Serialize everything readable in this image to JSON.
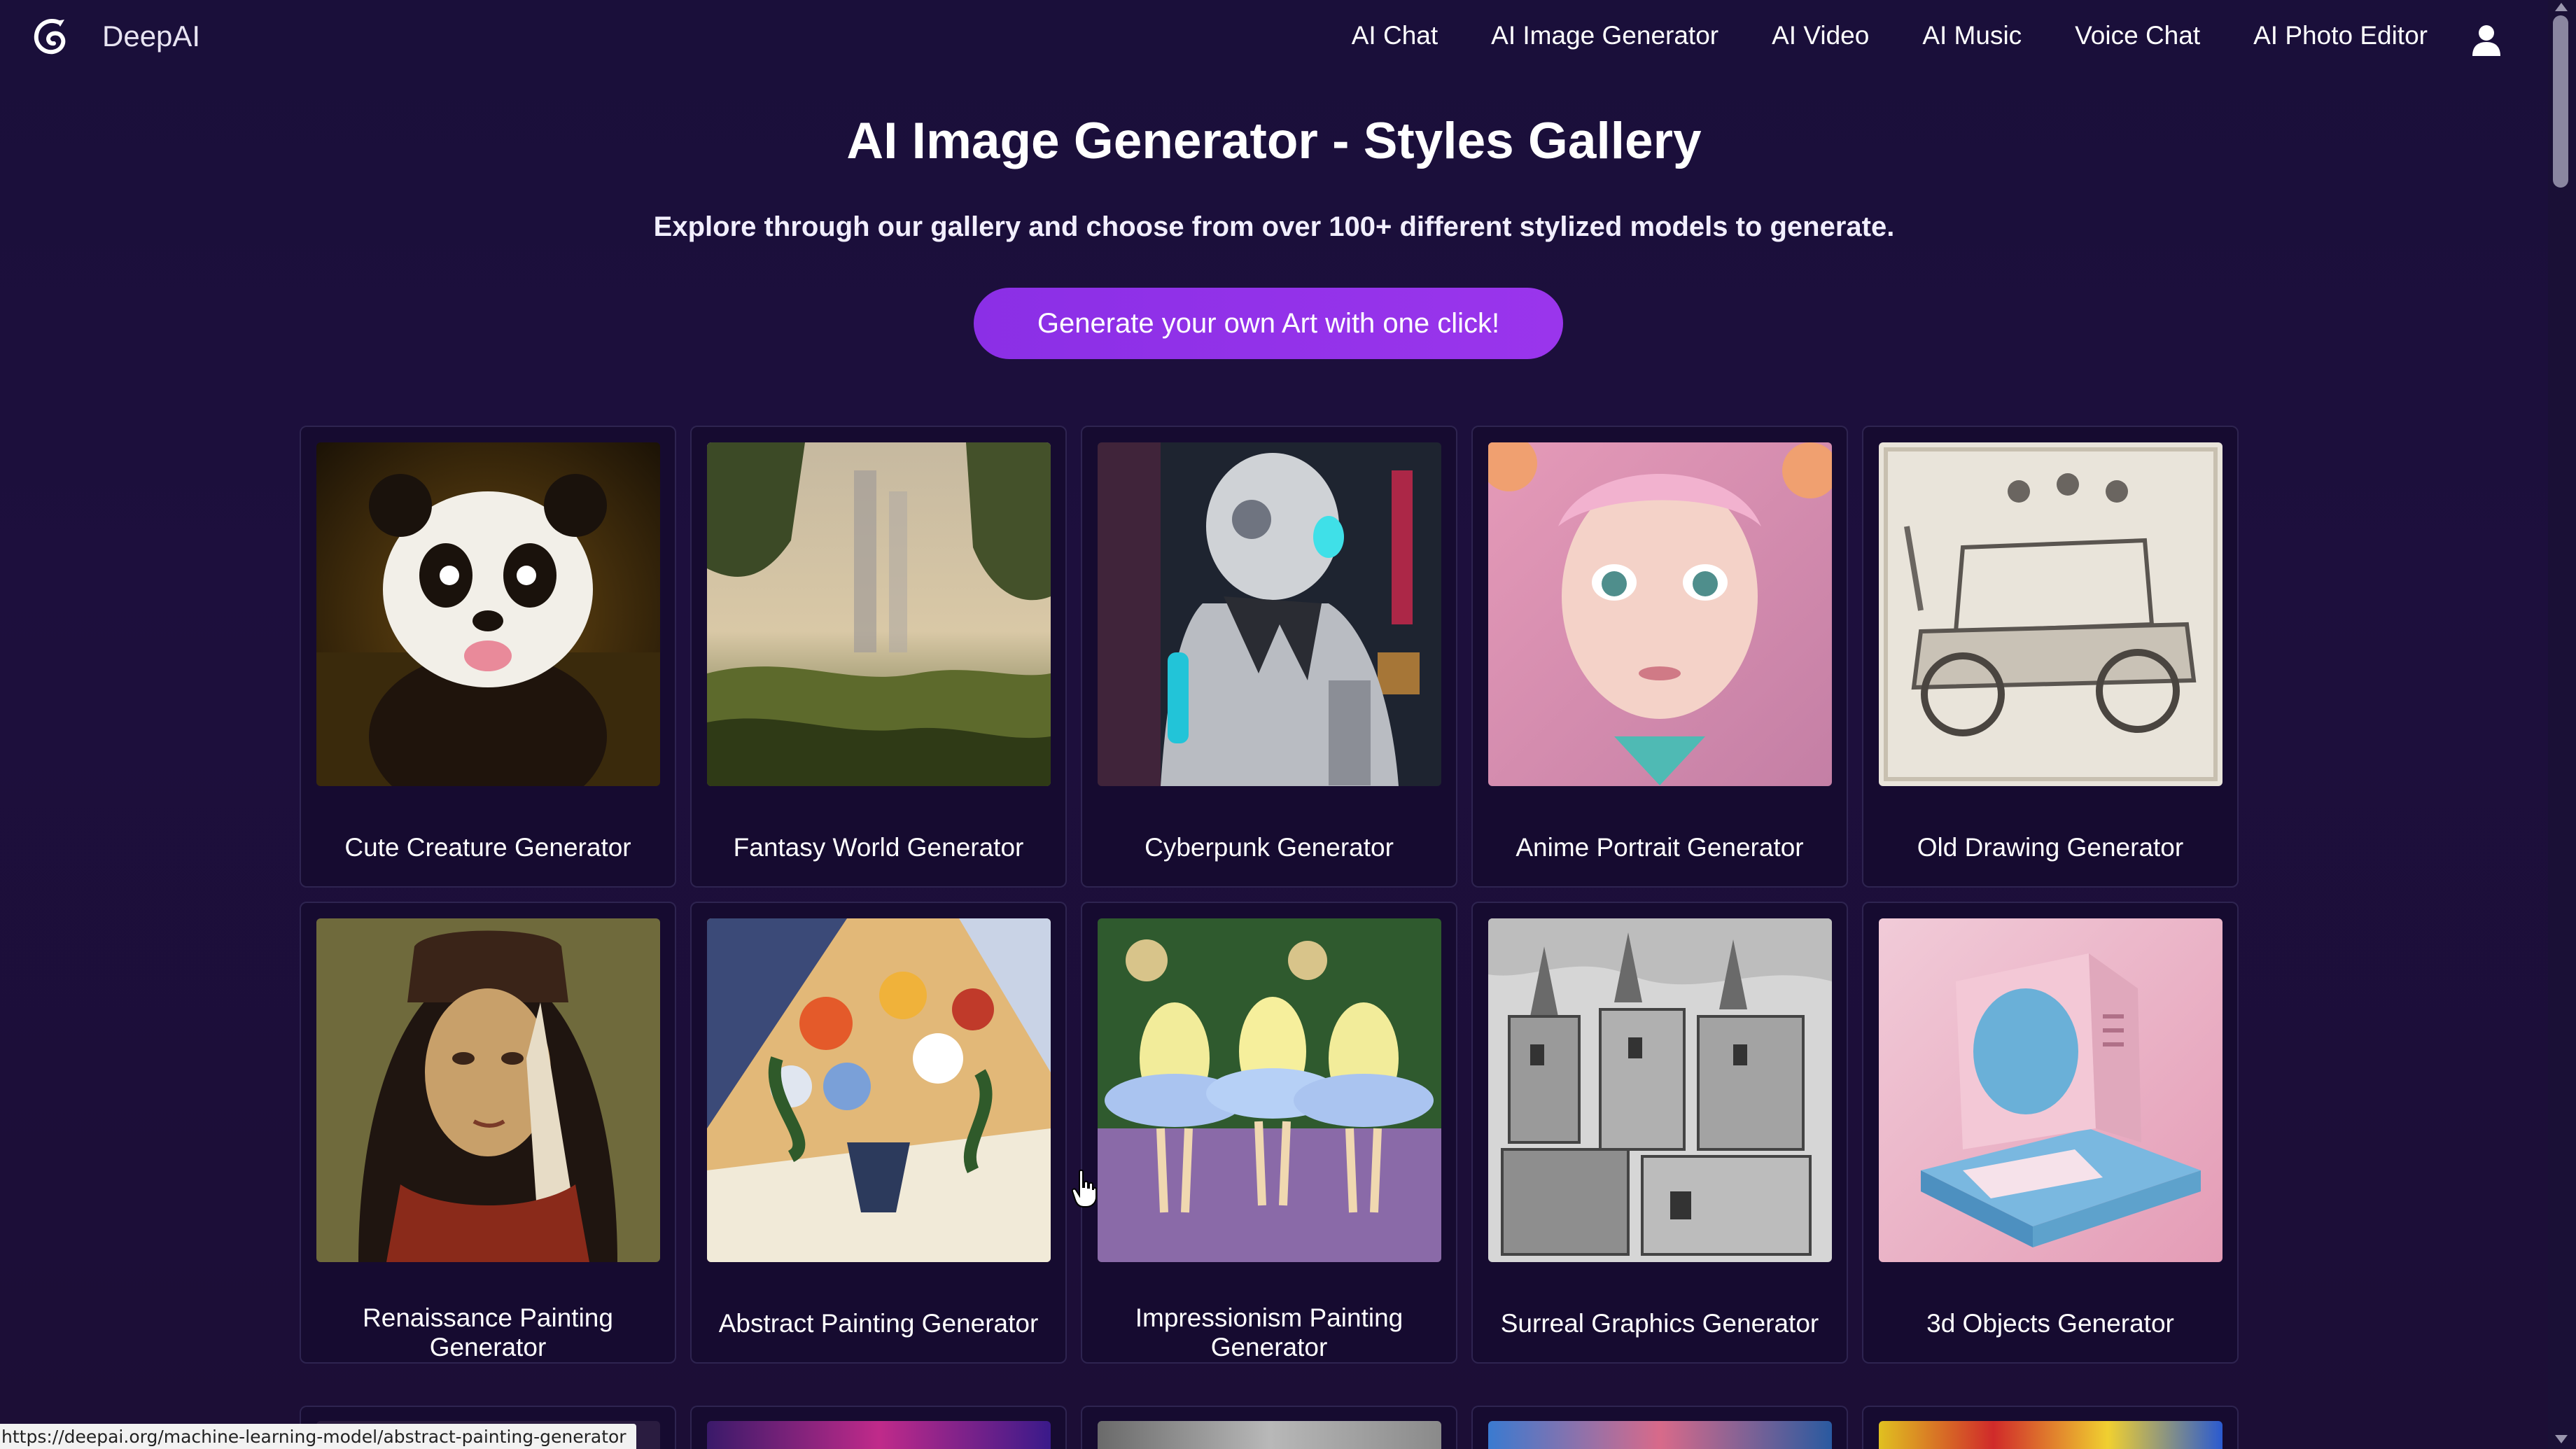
{
  "brand": {
    "name": "DeepAI"
  },
  "nav": {
    "links": [
      "AI Chat",
      "AI Image Generator",
      "AI Video",
      "AI Music",
      "Voice Chat",
      "AI Photo Editor"
    ]
  },
  "hero": {
    "title": "AI Image Generator - Styles Gallery",
    "subtitle": "Explore through our gallery and choose from over 100+ different stylized models to generate.",
    "cta": "Generate your own Art with one click!"
  },
  "gallery": {
    "cards": [
      {
        "label": "Cute Creature Generator"
      },
      {
        "label": "Fantasy World Generator"
      },
      {
        "label": "Cyberpunk Generator"
      },
      {
        "label": "Anime Portrait Generator"
      },
      {
        "label": "Old Drawing Generator"
      },
      {
        "label": "Renaissance Painting Generator"
      },
      {
        "label": "Abstract Painting Generator"
      },
      {
        "label": "Impressionism Painting Generator"
      },
      {
        "label": "Surreal Graphics Generator"
      },
      {
        "label": "3d Objects Generator"
      }
    ]
  },
  "status": {
    "url": "https://deepai.org/machine-learning-model/abstract-painting-generator"
  },
  "colors": {
    "background": "#1b0e38",
    "accent": "#9333ea",
    "card_border": "#2e2450"
  }
}
